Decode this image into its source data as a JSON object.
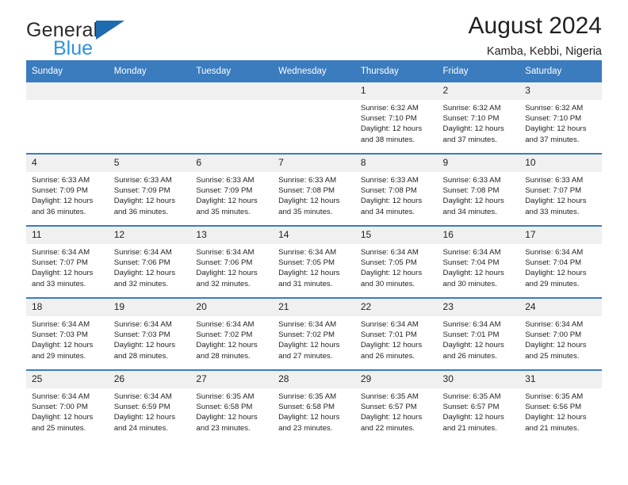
{
  "brand": {
    "name_top": "General",
    "name_bottom": "Blue",
    "logo_icon": "triangle-logo-icon",
    "accent_color": "#1f6bb0",
    "accent_color_light": "#2f93e0"
  },
  "header": {
    "title": "August 2024",
    "subtitle": "Kamba, Kebbi, Nigeria"
  },
  "calendar": {
    "header_bg": "#3b7cbf",
    "daynum_bg": "#f0f0f0",
    "weekday_headers": [
      "Sunday",
      "Monday",
      "Tuesday",
      "Wednesday",
      "Thursday",
      "Friday",
      "Saturday"
    ],
    "weeks": [
      [
        {
          "day": "",
          "empty": true,
          "sunrise": "",
          "sunset": "",
          "daylight_line1": "",
          "daylight_line2": ""
        },
        {
          "day": "",
          "empty": true,
          "sunrise": "",
          "sunset": "",
          "daylight_line1": "",
          "daylight_line2": ""
        },
        {
          "day": "",
          "empty": true,
          "sunrise": "",
          "sunset": "",
          "daylight_line1": "",
          "daylight_line2": ""
        },
        {
          "day": "",
          "empty": true,
          "sunrise": "",
          "sunset": "",
          "daylight_line1": "",
          "daylight_line2": ""
        },
        {
          "day": "1",
          "sunrise": "Sunrise: 6:32 AM",
          "sunset": "Sunset: 7:10 PM",
          "daylight_line1": "Daylight: 12 hours",
          "daylight_line2": "and 38 minutes."
        },
        {
          "day": "2",
          "sunrise": "Sunrise: 6:32 AM",
          "sunset": "Sunset: 7:10 PM",
          "daylight_line1": "Daylight: 12 hours",
          "daylight_line2": "and 37 minutes."
        },
        {
          "day": "3",
          "sunrise": "Sunrise: 6:32 AM",
          "sunset": "Sunset: 7:10 PM",
          "daylight_line1": "Daylight: 12 hours",
          "daylight_line2": "and 37 minutes."
        }
      ],
      [
        {
          "day": "4",
          "sunrise": "Sunrise: 6:33 AM",
          "sunset": "Sunset: 7:09 PM",
          "daylight_line1": "Daylight: 12 hours",
          "daylight_line2": "and 36 minutes."
        },
        {
          "day": "5",
          "sunrise": "Sunrise: 6:33 AM",
          "sunset": "Sunset: 7:09 PM",
          "daylight_line1": "Daylight: 12 hours",
          "daylight_line2": "and 36 minutes."
        },
        {
          "day": "6",
          "sunrise": "Sunrise: 6:33 AM",
          "sunset": "Sunset: 7:09 PM",
          "daylight_line1": "Daylight: 12 hours",
          "daylight_line2": "and 35 minutes."
        },
        {
          "day": "7",
          "sunrise": "Sunrise: 6:33 AM",
          "sunset": "Sunset: 7:08 PM",
          "daylight_line1": "Daylight: 12 hours",
          "daylight_line2": "and 35 minutes."
        },
        {
          "day": "8",
          "sunrise": "Sunrise: 6:33 AM",
          "sunset": "Sunset: 7:08 PM",
          "daylight_line1": "Daylight: 12 hours",
          "daylight_line2": "and 34 minutes."
        },
        {
          "day": "9",
          "sunrise": "Sunrise: 6:33 AM",
          "sunset": "Sunset: 7:08 PM",
          "daylight_line1": "Daylight: 12 hours",
          "daylight_line2": "and 34 minutes."
        },
        {
          "day": "10",
          "sunrise": "Sunrise: 6:33 AM",
          "sunset": "Sunset: 7:07 PM",
          "daylight_line1": "Daylight: 12 hours",
          "daylight_line2": "and 33 minutes."
        }
      ],
      [
        {
          "day": "11",
          "sunrise": "Sunrise: 6:34 AM",
          "sunset": "Sunset: 7:07 PM",
          "daylight_line1": "Daylight: 12 hours",
          "daylight_line2": "and 33 minutes."
        },
        {
          "day": "12",
          "sunrise": "Sunrise: 6:34 AM",
          "sunset": "Sunset: 7:06 PM",
          "daylight_line1": "Daylight: 12 hours",
          "daylight_line2": "and 32 minutes."
        },
        {
          "day": "13",
          "sunrise": "Sunrise: 6:34 AM",
          "sunset": "Sunset: 7:06 PM",
          "daylight_line1": "Daylight: 12 hours",
          "daylight_line2": "and 32 minutes."
        },
        {
          "day": "14",
          "sunrise": "Sunrise: 6:34 AM",
          "sunset": "Sunset: 7:05 PM",
          "daylight_line1": "Daylight: 12 hours",
          "daylight_line2": "and 31 minutes."
        },
        {
          "day": "15",
          "sunrise": "Sunrise: 6:34 AM",
          "sunset": "Sunset: 7:05 PM",
          "daylight_line1": "Daylight: 12 hours",
          "daylight_line2": "and 30 minutes."
        },
        {
          "day": "16",
          "sunrise": "Sunrise: 6:34 AM",
          "sunset": "Sunset: 7:04 PM",
          "daylight_line1": "Daylight: 12 hours",
          "daylight_line2": "and 30 minutes."
        },
        {
          "day": "17",
          "sunrise": "Sunrise: 6:34 AM",
          "sunset": "Sunset: 7:04 PM",
          "daylight_line1": "Daylight: 12 hours",
          "daylight_line2": "and 29 minutes."
        }
      ],
      [
        {
          "day": "18",
          "sunrise": "Sunrise: 6:34 AM",
          "sunset": "Sunset: 7:03 PM",
          "daylight_line1": "Daylight: 12 hours",
          "daylight_line2": "and 29 minutes."
        },
        {
          "day": "19",
          "sunrise": "Sunrise: 6:34 AM",
          "sunset": "Sunset: 7:03 PM",
          "daylight_line1": "Daylight: 12 hours",
          "daylight_line2": "and 28 minutes."
        },
        {
          "day": "20",
          "sunrise": "Sunrise: 6:34 AM",
          "sunset": "Sunset: 7:02 PM",
          "daylight_line1": "Daylight: 12 hours",
          "daylight_line2": "and 28 minutes."
        },
        {
          "day": "21",
          "sunrise": "Sunrise: 6:34 AM",
          "sunset": "Sunset: 7:02 PM",
          "daylight_line1": "Daylight: 12 hours",
          "daylight_line2": "and 27 minutes."
        },
        {
          "day": "22",
          "sunrise": "Sunrise: 6:34 AM",
          "sunset": "Sunset: 7:01 PM",
          "daylight_line1": "Daylight: 12 hours",
          "daylight_line2": "and 26 minutes."
        },
        {
          "day": "23",
          "sunrise": "Sunrise: 6:34 AM",
          "sunset": "Sunset: 7:01 PM",
          "daylight_line1": "Daylight: 12 hours",
          "daylight_line2": "and 26 minutes."
        },
        {
          "day": "24",
          "sunrise": "Sunrise: 6:34 AM",
          "sunset": "Sunset: 7:00 PM",
          "daylight_line1": "Daylight: 12 hours",
          "daylight_line2": "and 25 minutes."
        }
      ],
      [
        {
          "day": "25",
          "sunrise": "Sunrise: 6:34 AM",
          "sunset": "Sunset: 7:00 PM",
          "daylight_line1": "Daylight: 12 hours",
          "daylight_line2": "and 25 minutes."
        },
        {
          "day": "26",
          "sunrise": "Sunrise: 6:34 AM",
          "sunset": "Sunset: 6:59 PM",
          "daylight_line1": "Daylight: 12 hours",
          "daylight_line2": "and 24 minutes."
        },
        {
          "day": "27",
          "sunrise": "Sunrise: 6:35 AM",
          "sunset": "Sunset: 6:58 PM",
          "daylight_line1": "Daylight: 12 hours",
          "daylight_line2": "and 23 minutes."
        },
        {
          "day": "28",
          "sunrise": "Sunrise: 6:35 AM",
          "sunset": "Sunset: 6:58 PM",
          "daylight_line1": "Daylight: 12 hours",
          "daylight_line2": "and 23 minutes."
        },
        {
          "day": "29",
          "sunrise": "Sunrise: 6:35 AM",
          "sunset": "Sunset: 6:57 PM",
          "daylight_line1": "Daylight: 12 hours",
          "daylight_line2": "and 22 minutes."
        },
        {
          "day": "30",
          "sunrise": "Sunrise: 6:35 AM",
          "sunset": "Sunset: 6:57 PM",
          "daylight_line1": "Daylight: 12 hours",
          "daylight_line2": "and 21 minutes."
        },
        {
          "day": "31",
          "sunrise": "Sunrise: 6:35 AM",
          "sunset": "Sunset: 6:56 PM",
          "daylight_line1": "Daylight: 12 hours",
          "daylight_line2": "and 21 minutes."
        }
      ]
    ]
  }
}
